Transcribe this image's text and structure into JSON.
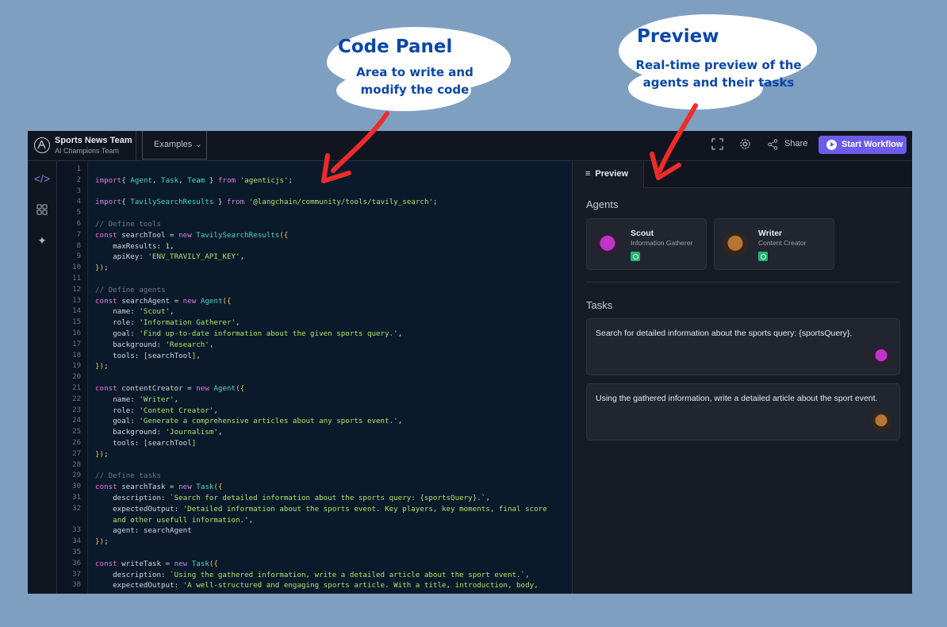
{
  "annotations": {
    "code_panel": {
      "title": "Code Panel",
      "subtitle_line1": "Area to write and",
      "subtitle_line2": "modify the code"
    },
    "preview": {
      "title": "Preview",
      "subtitle_line1": "Real-time preview of the",
      "subtitle_line2": "agents and their tasks"
    },
    "arrow_color": "#ee2b2b"
  },
  "header": {
    "team_name": "Sports News Team",
    "team_subtitle": "AI Champions Team",
    "examples_label": "Examples",
    "share_label": "Share",
    "start_label": "Start Workflow",
    "accent": "#6c5ce7"
  },
  "sidebar": {
    "icons": [
      "code-icon",
      "grid-icon",
      "sparkles-icon"
    ]
  },
  "editor": {
    "lines": [
      [
        [
          "",
          ""
        ]
      ],
      [
        [
          "kw",
          "import"
        ],
        [
          "",
          "{ "
        ],
        [
          "cls",
          "Agent"
        ],
        [
          "",
          ", "
        ],
        [
          "cls",
          "Task"
        ],
        [
          "",
          ", "
        ],
        [
          "cls",
          "Team"
        ],
        [
          "",
          " } "
        ],
        [
          "kw",
          "from"
        ],
        [
          "",
          " "
        ],
        [
          "str",
          "'agenticjs'"
        ],
        [
          "",
          ";"
        ]
      ],
      [
        [
          "",
          ""
        ]
      ],
      [
        [
          "kw",
          "import"
        ],
        [
          "",
          "{ "
        ],
        [
          "cls",
          "TavilySearchResults"
        ],
        [
          "",
          " } "
        ],
        [
          "kw",
          "from"
        ],
        [
          "",
          " "
        ],
        [
          "str",
          "'@langchain/community/tools/tavily_search'"
        ],
        [
          "",
          ";"
        ]
      ],
      [
        [
          "",
          ""
        ]
      ],
      [
        [
          "cm",
          "// Define tools"
        ]
      ],
      [
        [
          "kw",
          "const"
        ],
        [
          "",
          " searchTool = "
        ],
        [
          "kw",
          "new"
        ],
        [
          "",
          " "
        ],
        [
          "cls",
          "TavilySearchResults"
        ],
        [
          "br",
          "({"
        ]
      ],
      [
        [
          "",
          "    maxResults: 1,"
        ]
      ],
      [
        [
          "",
          "    apiKey: "
        ],
        [
          "str",
          "'ENV_TRAVILY_API_KEY'"
        ],
        [
          "",
          ","
        ]
      ],
      [
        [
          "br",
          "})"
        ],
        [
          "",
          ";"
        ]
      ],
      [
        [
          "",
          ""
        ]
      ],
      [
        [
          "cm",
          "// Define agents"
        ]
      ],
      [
        [
          "kw",
          "const"
        ],
        [
          "",
          " searchAgent = "
        ],
        [
          "kw",
          "new"
        ],
        [
          "",
          " "
        ],
        [
          "cls",
          "Agent"
        ],
        [
          "br",
          "({"
        ]
      ],
      [
        [
          "",
          "    name: "
        ],
        [
          "str",
          "'Scout'"
        ],
        [
          "",
          ","
        ]
      ],
      [
        [
          "",
          "    role: "
        ],
        [
          "str",
          "'Information Gatherer'"
        ],
        [
          "",
          ","
        ]
      ],
      [
        [
          "",
          "    goal: "
        ],
        [
          "str",
          "'Find up-to-date information about the given sports query.'"
        ],
        [
          "",
          ","
        ]
      ],
      [
        [
          "",
          "    background: "
        ],
        [
          "str",
          "'Research'"
        ],
        [
          "",
          ","
        ]
      ],
      [
        [
          "",
          "    tools: "
        ],
        [
          "br",
          "["
        ],
        [
          "",
          "searchTool"
        ],
        [
          "br",
          "]"
        ],
        [
          "",
          ","
        ]
      ],
      [
        [
          "br",
          "})"
        ],
        [
          "",
          ";"
        ]
      ],
      [
        [
          "",
          ""
        ]
      ],
      [
        [
          "kw",
          "const"
        ],
        [
          "",
          " contentCreator = "
        ],
        [
          "kw",
          "new"
        ],
        [
          "",
          " "
        ],
        [
          "cls",
          "Agent"
        ],
        [
          "br",
          "({"
        ]
      ],
      [
        [
          "",
          "    name: "
        ],
        [
          "str",
          "'Writer'"
        ],
        [
          "",
          ","
        ]
      ],
      [
        [
          "",
          "    role: "
        ],
        [
          "str",
          "'Content Creator'"
        ],
        [
          "",
          ","
        ]
      ],
      [
        [
          "",
          "    goal: "
        ],
        [
          "str",
          "'Generate a comprehensive articles about any sports event.'"
        ],
        [
          "",
          ","
        ]
      ],
      [
        [
          "",
          "    background: "
        ],
        [
          "str",
          "'Journalism'"
        ],
        [
          "",
          ","
        ]
      ],
      [
        [
          "",
          "    tools: "
        ],
        [
          "br",
          "["
        ],
        [
          "",
          "searchTool"
        ],
        [
          "br",
          "]"
        ]
      ],
      [
        [
          "br",
          "})"
        ],
        [
          "",
          ";"
        ]
      ],
      [
        [
          "",
          ""
        ]
      ],
      [
        [
          "cm",
          "// Define tasks"
        ]
      ],
      [
        [
          "kw",
          "const"
        ],
        [
          "",
          " searchTask = "
        ],
        [
          "kw",
          "new"
        ],
        [
          "",
          " "
        ],
        [
          "cls",
          "Task"
        ],
        [
          "br",
          "({"
        ]
      ],
      [
        [
          "",
          "    description: "
        ],
        [
          "str",
          "`Search for detailed information about the sports query: {sportsQuery}.`"
        ],
        [
          "",
          ","
        ]
      ],
      [
        [
          "",
          "    expectedOutput: "
        ],
        [
          "str",
          "'Detailed information about the sports event. Key players, key moments, final score"
        ]
      ],
      [
        [
          "str",
          "    and other usefull information.'"
        ],
        [
          "",
          ","
        ]
      ],
      [
        [
          "",
          "    agent: searchAgent"
        ]
      ],
      [
        [
          "br",
          "})"
        ],
        [
          "",
          ";"
        ]
      ],
      [
        [
          "",
          ""
        ]
      ],
      [
        [
          "kw",
          "const"
        ],
        [
          "",
          " writeTask = "
        ],
        [
          "kw",
          "new"
        ],
        [
          "",
          " "
        ],
        [
          "cls",
          "Task"
        ],
        [
          "br",
          "({"
        ]
      ],
      [
        [
          "",
          "    description: "
        ],
        [
          "str",
          "`Using the gathered information, write a detailed article about the sport event.`"
        ],
        [
          "",
          ","
        ]
      ],
      [
        [
          "",
          "    expectedOutput: "
        ],
        [
          "str",
          "'A well-structured and engaging sports article. With a title, introduction, body,"
        ]
      ]
    ],
    "line_numbers": [
      "1",
      "2",
      "3",
      "4",
      "5",
      "6",
      "7",
      "8",
      "9",
      "10",
      "11",
      "12",
      "13",
      "14",
      "15",
      "16",
      "17",
      "18",
      "19",
      "20",
      "21",
      "22",
      "23",
      "24",
      "25",
      "26",
      "27",
      "28",
      "29",
      "30",
      "31",
      "32",
      "",
      "33",
      "34",
      "35",
      "36",
      "37",
      "38"
    ]
  },
  "preview_panel": {
    "tab_label": "Preview",
    "agents_heading": "Agents",
    "agents": [
      {
        "name": "Scout",
        "role": "Information Gatherer",
        "avatar_color": "#b02ab8"
      },
      {
        "name": "Writer",
        "role": "Content Creator",
        "avatar_color": "#a8672e"
      }
    ],
    "tasks_heading": "Tasks",
    "tasks": [
      {
        "description": "Search for detailed information about the sports query: {sportsQuery}.",
        "avatar_color": "#b02ab8"
      },
      {
        "description": "Using the gathered information, write a detailed article about the sport event.",
        "avatar_color": "#a8672e"
      }
    ]
  }
}
